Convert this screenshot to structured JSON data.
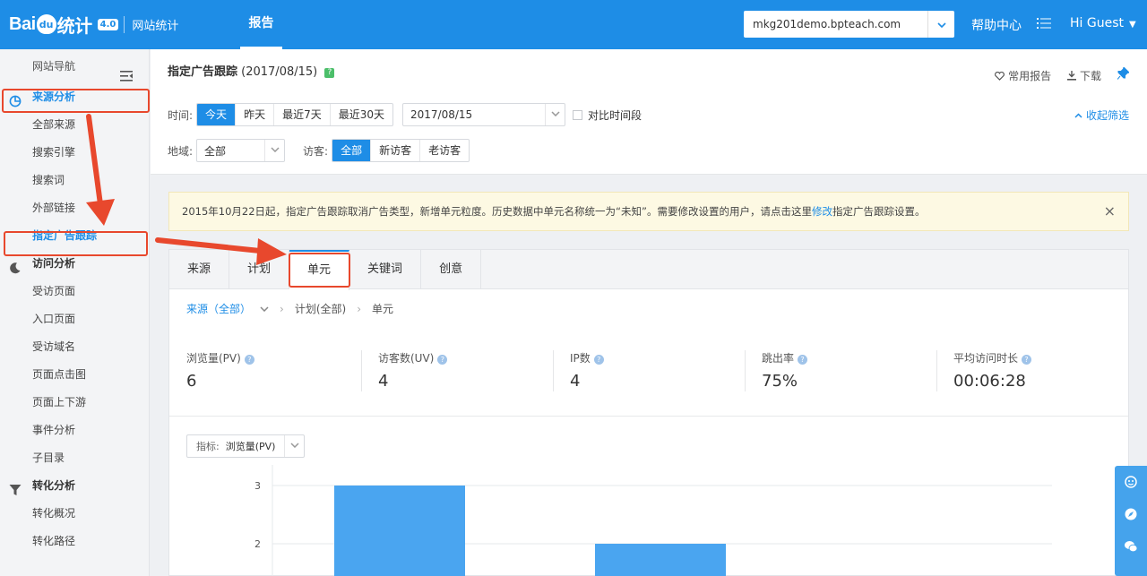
{
  "header": {
    "logo_text_a": "Bai",
    "logo_paw": "du",
    "logo_text_b": "统计",
    "logo_version": "4.0",
    "logo_sub": "网站统计",
    "nav_report": "报告",
    "site_value": "mkg201demo.bpteach.com",
    "help": "帮助中心",
    "user": "Hi Guest"
  },
  "sidebar": {
    "nav_title": "网站导航",
    "sections": [
      {
        "label": "来源分析",
        "icon": "pie-chart-icon",
        "items": [
          "全部来源",
          "搜索引擎",
          "搜索词",
          "外部链接",
          "指定广告跟踪"
        ]
      },
      {
        "label": "访问分析",
        "icon": "moon-icon",
        "items": [
          "受访页面",
          "入口页面",
          "受访域名",
          "页面点击图",
          "页面上下游",
          "事件分析",
          "子目录"
        ]
      },
      {
        "label": "转化分析",
        "icon": "funnel-icon",
        "items": [
          "转化概况",
          "转化路径"
        ]
      }
    ]
  },
  "page": {
    "title": "指定广告跟踪",
    "date": "(2017/08/15)",
    "favorite": "常用报告",
    "download": "下载"
  },
  "filters": {
    "time_label": "时间:",
    "time_options": [
      "今天",
      "昨天",
      "最近7天",
      "最近30天"
    ],
    "date_value": "2017/08/15",
    "compare": "对比时间段",
    "collapse": "收起筛选",
    "region_label": "地域:",
    "region_value": "全部",
    "visitor_label": "访客:",
    "visitor_options": [
      "全部",
      "新访客",
      "老访客"
    ]
  },
  "notice": {
    "text_a": "2015年10月22日起，指定广告跟踪取消广告类型，新增单元粒度。历史数据中单元名称统一为“未知”。需要修改设置的用户，请点击这里",
    "link": "修改",
    "text_b": "指定广告跟踪设置。",
    "close": "×"
  },
  "tabs": [
    "来源",
    "计划",
    "单元",
    "关键词",
    "创意"
  ],
  "breadcrumb": {
    "a": "来源（全部）",
    "b": "计划(全部)",
    "c": "单元"
  },
  "metrics": [
    {
      "label": "浏览量(PV)",
      "value": "6"
    },
    {
      "label": "访客数(UV)",
      "value": "4"
    },
    {
      "label": "IP数",
      "value": "4"
    },
    {
      "label": "跳出率",
      "value": "75%"
    },
    {
      "label": "平均访问时长",
      "value": "00:06:28"
    }
  ],
  "indicator": {
    "label": "指标:",
    "value": "浏览量(PV)"
  },
  "chart_data": {
    "type": "bar",
    "title": "",
    "xlabel": "",
    "ylabel": "",
    "y_ticks": [
      "3",
      "2"
    ],
    "values": [
      3,
      2
    ],
    "color": "#4aa5f0"
  },
  "colors": {
    "brand": "#1e8de6",
    "annotation": "#e8482d"
  }
}
